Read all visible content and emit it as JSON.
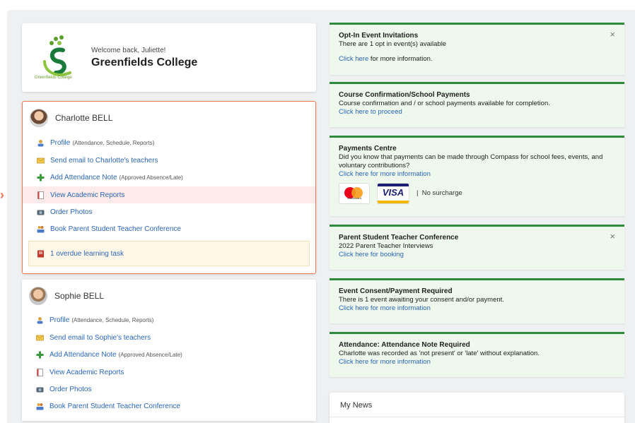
{
  "header": {
    "welcome": "Welcome back, Juliette!",
    "school_name": "Greenfields College",
    "logo_caption": "Greenfields College"
  },
  "students": [
    {
      "name": "Charlotte BELL",
      "menu": [
        {
          "label": "Profile",
          "note": "(Attendance, Schedule, Reports)",
          "icon": "person-icon"
        },
        {
          "label": "Send email to Charlotte's teachers",
          "note": "",
          "icon": "mail-icon"
        },
        {
          "label": "Add Attendance Note",
          "note": "(Approved Absence/Late)",
          "icon": "plus-icon"
        },
        {
          "label": "View Academic Reports",
          "note": "",
          "icon": "report-icon"
        },
        {
          "label": "Order Photos",
          "note": "",
          "icon": "camera-icon"
        },
        {
          "label": "Book Parent Student Teacher Conference",
          "note": "",
          "icon": "conference-icon"
        }
      ],
      "overdue": "1 overdue learning task"
    },
    {
      "name": "Sophie BELL",
      "menu": [
        {
          "label": "Profile",
          "note": "(Attendance, Schedule, Reports)",
          "icon": "person-icon"
        },
        {
          "label": "Send email to Sophie's teachers",
          "note": "",
          "icon": "mail-icon"
        },
        {
          "label": "Add Attendance Note",
          "note": "(Approved Absence/Late)",
          "icon": "plus-icon"
        },
        {
          "label": "View Academic Reports",
          "note": "",
          "icon": "report-icon"
        },
        {
          "label": "Order Photos",
          "note": "",
          "icon": "camera-icon"
        },
        {
          "label": "Book Parent Student Teacher Conference",
          "note": "",
          "icon": "conference-icon"
        }
      ]
    }
  ],
  "notices": [
    {
      "title": "Opt-In Event Invitations",
      "body": "There are 1 opt in event(s) available",
      "link": "Click here",
      "link_suffix": " for more information.",
      "close": "×"
    },
    {
      "title": "Course Confirmation/School Payments",
      "body": "Course confirmation and / or school payments available for completion.",
      "link": "Click here to proceed"
    },
    {
      "title": "Payments Centre",
      "body": "Did you know that payments can be made through Compass for school fees, events, and voluntary contributions?",
      "link": "Click here for more information",
      "mastercard": "mastercard",
      "visa": "VISA",
      "surcharge": "No surcharge"
    },
    {
      "title": "Parent Student Teacher Conference",
      "body": "2022 Parent Teacher Interviews",
      "link": "Click here for booking",
      "close": "×"
    },
    {
      "title": "Event Consent/Payment Required",
      "body": "There is 1 event awaiting your consent and/or payment.",
      "link": "Click here for more information"
    },
    {
      "title": "Attendance: Attendance Note Required",
      "body": "Charlotte was recorded as 'not present' or 'late' without explanation.",
      "link": "Click here for more information"
    }
  ],
  "news": {
    "title": "My News"
  },
  "colors": {
    "accent_green": "#2e8b3c",
    "link_blue": "#2a66b8",
    "highlight_orange": "#f07650"
  }
}
